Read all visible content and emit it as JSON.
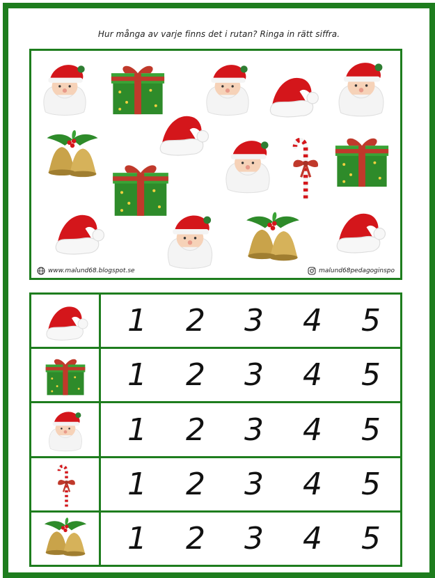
{
  "instruction": "Hur många av varje finns det i rutan? Ringa in rätt siffra.",
  "footer": {
    "website": "www.malund68.blogspot.se",
    "instagram": "malund68pedagoginspo"
  },
  "scene_items": [
    "santa",
    "gift",
    "santa",
    "hat",
    "santa",
    "bells",
    "hat",
    "santa",
    "candycane",
    "gift",
    "gift",
    "hat",
    "santa",
    "bells",
    "hat"
  ],
  "rows": [
    {
      "icon": "hat",
      "numbers": [
        "1",
        "2",
        "3",
        "4",
        "5"
      ]
    },
    {
      "icon": "gift",
      "numbers": [
        "1",
        "2",
        "3",
        "4",
        "5"
      ]
    },
    {
      "icon": "santa",
      "numbers": [
        "1",
        "2",
        "3",
        "4",
        "5"
      ]
    },
    {
      "icon": "candycane",
      "numbers": [
        "1",
        "2",
        "3",
        "4",
        "5"
      ]
    },
    {
      "icon": "bells",
      "numbers": [
        "1",
        "2",
        "3",
        "4",
        "5"
      ]
    }
  ],
  "colors": {
    "border": "#1e7d1e",
    "santa_red": "#d4161b",
    "gift_green": "#2e8b2a",
    "ribbon": "#c0392b",
    "bell_gold": "#c9a34a"
  }
}
